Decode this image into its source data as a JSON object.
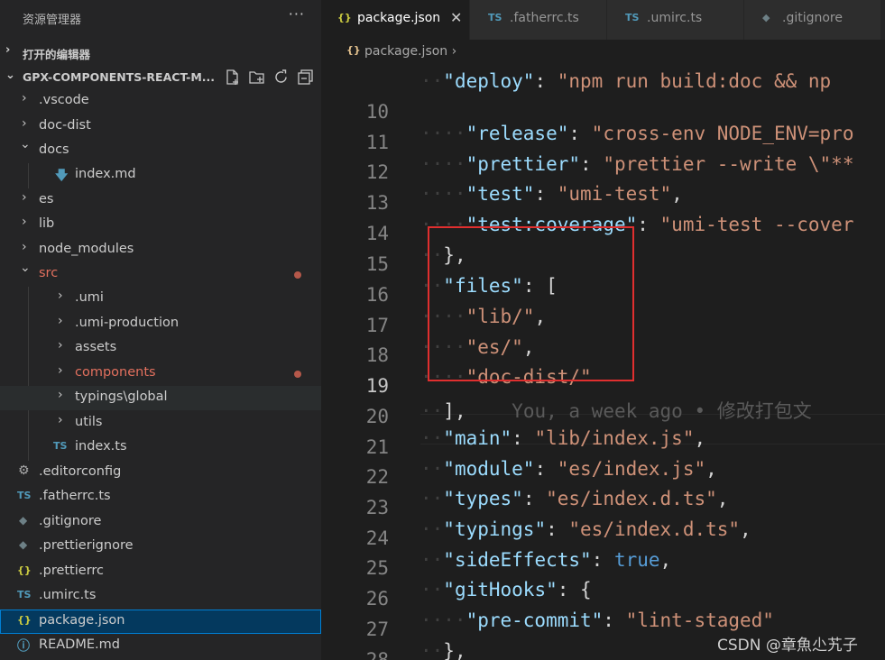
{
  "sidebar": {
    "title": "资源管理器",
    "more": "···",
    "open_editors_label": "打开的编辑器",
    "project_label": "GPX-COMPONENTS-REACT-M...",
    "items": [
      {
        "label": ".vscode",
        "chevron": "›"
      },
      {
        "label": "doc-dist",
        "chevron": "›"
      },
      {
        "label": "docs",
        "chevron": "⌄"
      },
      {
        "label": "index.md",
        "icon": "🡇"
      },
      {
        "label": "es",
        "chevron": "›"
      },
      {
        "label": "lib",
        "chevron": "›"
      },
      {
        "label": "node_modules",
        "chevron": "›"
      },
      {
        "label": "src",
        "chevron": "⌄"
      },
      {
        "label": ".umi",
        "chevron": "›"
      },
      {
        "label": ".umi-production",
        "chevron": "›"
      },
      {
        "label": "assets",
        "chevron": "›"
      },
      {
        "label": "components",
        "chevron": "›"
      },
      {
        "label": "typings\\global",
        "chevron": "›"
      },
      {
        "label": "utils",
        "chevron": "›"
      },
      {
        "label": "index.ts",
        "icon": "TS"
      },
      {
        "label": ".editorconfig",
        "icon": "⚙"
      },
      {
        "label": ".fatherrc.ts",
        "icon": "TS"
      },
      {
        "label": ".gitignore",
        "icon": "◆"
      },
      {
        "label": ".prettierignore",
        "icon": "◆"
      },
      {
        "label": ".prettierrc",
        "icon": "{}"
      },
      {
        "label": ".umirc.ts",
        "icon": "TS"
      },
      {
        "label": "package.json",
        "icon": "{}"
      },
      {
        "label": "README.md",
        "icon": "ⓘ"
      }
    ]
  },
  "tabs": [
    {
      "label": "package.json",
      "icon": "{}",
      "close": "✕"
    },
    {
      "label": ".fatherrc.ts",
      "icon": "TS"
    },
    {
      "label": ".umirc.ts",
      "icon": "TS"
    },
    {
      "label": ".gitignore",
      "icon": "◆"
    }
  ],
  "breadcrumb": {
    "icon": "{}",
    "label": "package.json",
    "sep": "›"
  },
  "code": {
    "line_numbers": [
      "10",
      "11",
      "12",
      "13",
      "14",
      "15",
      "16",
      "17",
      "18",
      "19",
      "20",
      "21",
      "22",
      "23",
      "24",
      "25",
      "26",
      "27",
      "28"
    ],
    "partial_top": "\"deploy\": \"npm run build:doc && np",
    "blame": "You, a week ago • 修改打包文"
  },
  "watermark": "CSDN @章魚尐艽子",
  "colors": {
    "highlight_box": "#e02f2f",
    "modified": "#e2705e",
    "selected": "#04395e"
  }
}
